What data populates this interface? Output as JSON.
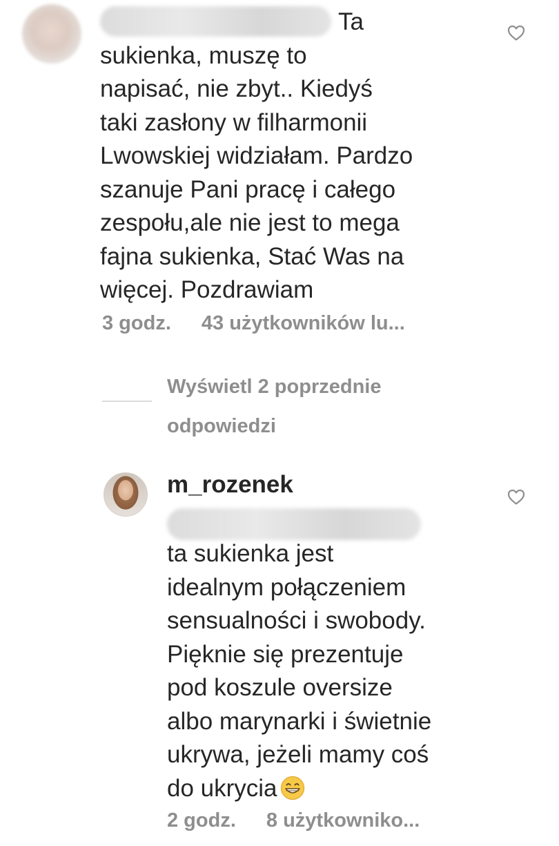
{
  "comments": [
    {
      "username": "",
      "text_lines": [
        "Ta",
        "sukienka, muszę to",
        "napisać, nie zbyt.. Kiedyś",
        "taki zasłony w filharmonii",
        "Lwowskiej widziałam. Pardzo",
        "szanuje Pani pracę i całego",
        "zespołu,ale nie jest to mega",
        "fajna sukienka, Stać Was na",
        "więcej. Pozdrawiam"
      ],
      "time": "3 godz.",
      "likes": "43 użytkowników lu..."
    },
    {
      "username": "m_rozenek",
      "mention": "",
      "text_lines": [
        "ta sukienka jest",
        "idealnym połączeniem",
        "sensualności i swobody.",
        "Pięknie się prezentuje",
        "pod koszule oversize",
        "albo marynarki i świetnie",
        "ukrywa, jeżeli mamy coś",
        "do ukrycia"
      ],
      "emoji": "grinning-face-emoji",
      "time": "2 godz.",
      "likes": "8 użytkowniko..."
    }
  ],
  "view_replies": {
    "line1": "Wyświetl 2 poprzednie",
    "line2": "odpowiedzi"
  },
  "icons": {
    "like": "heart-outline-icon"
  },
  "colors": {
    "text": "#262626",
    "secondary": "#8e8e8e",
    "divider": "#dbdbdb",
    "emoji": "#f7c948"
  }
}
